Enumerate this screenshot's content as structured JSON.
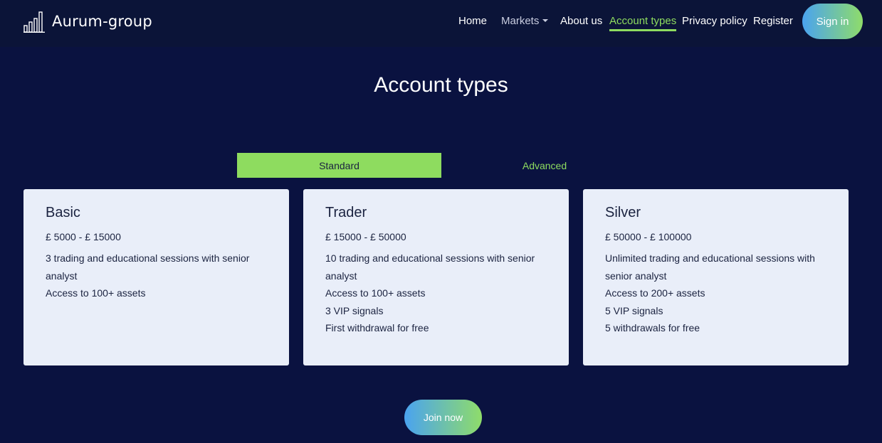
{
  "brand": {
    "name": "Aurum-group",
    "icon": "bar-chart-logo-icon"
  },
  "nav": {
    "home": "Home",
    "markets": "Markets",
    "about": "About us",
    "account_types": "Account types",
    "privacy": "Privacy policy",
    "register": "Register",
    "signin": "Sign in"
  },
  "page": {
    "title": "Account types"
  },
  "tabs": {
    "standard": "Standard",
    "advanced": "Advanced",
    "selected": "Standard"
  },
  "cards": [
    {
      "title": "Basic",
      "range": "£ 5000 - £ 15000",
      "features": [
        "3 trading and educational sessions with senior analyst",
        "Access to 100+ assets"
      ]
    },
    {
      "title": "Trader",
      "range": "£ 15000 - £ 50000",
      "features": [
        "10 trading and educational sessions with senior analyst",
        "Access to 100+ assets",
        "3 VIP signals",
        "First withdrawal for free"
      ]
    },
    {
      "title": "Silver",
      "range": "£ 50000 - £ 100000",
      "features": [
        "Unlimited trading and educational sessions with senior analyst",
        "Access to 200+ assets",
        "5 VIP signals",
        "5 withdrawals for free"
      ]
    }
  ],
  "cta": {
    "join": "Join now"
  },
  "colors": {
    "background": "#0a1240",
    "accent_green": "#8edc5f",
    "accent_blue": "#4aa3f0",
    "card_bg": "#e9eef9"
  }
}
